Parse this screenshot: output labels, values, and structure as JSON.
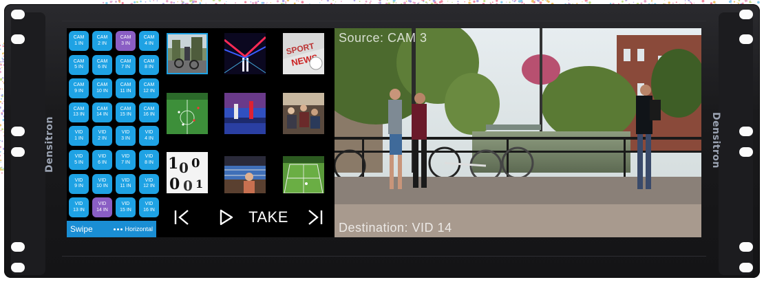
{
  "device": {
    "brand": "Densitron"
  },
  "router": {
    "buttons": [
      {
        "line1": "CAM",
        "line2": "1 IN",
        "selected": false
      },
      {
        "line1": "CAM",
        "line2": "2 IN",
        "selected": false
      },
      {
        "line1": "CAM",
        "line2": "3 IN",
        "selected": true
      },
      {
        "line1": "CAM",
        "line2": "4 IN",
        "selected": false
      },
      {
        "line1": "CAM",
        "line2": "5 IN",
        "selected": false
      },
      {
        "line1": "CAM",
        "line2": "6 IN",
        "selected": false
      },
      {
        "line1": "CAM",
        "line2": "7 IN",
        "selected": false
      },
      {
        "line1": "CAM",
        "line2": "8 IN",
        "selected": false
      },
      {
        "line1": "CAM",
        "line2": "9 IN",
        "selected": false
      },
      {
        "line1": "CAM",
        "line2": "10 IN",
        "selected": false
      },
      {
        "line1": "CAM",
        "line2": "11 IN",
        "selected": false
      },
      {
        "line1": "CAM",
        "line2": "12 IN",
        "selected": false
      },
      {
        "line1": "CAM",
        "line2": "13 IN",
        "selected": false
      },
      {
        "line1": "CAM",
        "line2": "14 IN",
        "selected": false
      },
      {
        "line1": "CAM",
        "line2": "15 IN",
        "selected": false
      },
      {
        "line1": "CAM",
        "line2": "16 IN",
        "selected": false
      },
      {
        "line1": "VID",
        "line2": "1 IN",
        "selected": false
      },
      {
        "line1": "VID",
        "line2": "2 IN",
        "selected": false
      },
      {
        "line1": "VID",
        "line2": "3 IN",
        "selected": false
      },
      {
        "line1": "VID",
        "line2": "4 IN",
        "selected": false
      },
      {
        "line1": "VID",
        "line2": "5 IN",
        "selected": false
      },
      {
        "line1": "VID",
        "line2": "6 IN",
        "selected": false
      },
      {
        "line1": "VID",
        "line2": "7 IN",
        "selected": false
      },
      {
        "line1": "VID",
        "line2": "8 IN",
        "selected": false
      },
      {
        "line1": "VID",
        "line2": "9 IN",
        "selected": false
      },
      {
        "line1": "VID",
        "line2": "10 IN",
        "selected": false
      },
      {
        "line1": "VID",
        "line2": "11 IN",
        "selected": false
      },
      {
        "line1": "VID",
        "line2": "12 IN",
        "selected": false
      },
      {
        "line1": "VID",
        "line2": "13 IN",
        "selected": false
      },
      {
        "line1": "VID",
        "line2": "14 IN",
        "selected": true
      },
      {
        "line1": "VID",
        "line2": "15 IN",
        "selected": false
      },
      {
        "line1": "VID",
        "line2": "16 IN",
        "selected": false
      }
    ],
    "swipe_label": "Swipe",
    "swipe_direction": "Horizontal"
  },
  "thumbnails": [
    {
      "name": "street-cyclists-thumb",
      "active": true
    },
    {
      "name": "neon-tunnel-thumb",
      "active": false
    },
    {
      "name": "sports-news-logo-thumb",
      "active": false
    },
    {
      "name": "soccer-pitch-thumb",
      "active": false
    },
    {
      "name": "arena-crowd-thumb",
      "active": false
    },
    {
      "name": "studio-crowd-thumb",
      "active": false
    },
    {
      "name": "countdown-leader-thumb",
      "active": false
    },
    {
      "name": "boxing-ring-thumb",
      "active": false
    },
    {
      "name": "tennis-court-thumb",
      "active": false
    }
  ],
  "transport": {
    "first_icon": "skip-to-start-icon",
    "play_icon": "play-icon",
    "take_label": "TAKE",
    "last_icon": "skip-to-end-icon"
  },
  "preview": {
    "source_label": "Source: CAM 3",
    "destination_label": "Destination: VID 14"
  },
  "colors": {
    "button_blue": "#1ea2e4",
    "button_selected": "#8a5ec4",
    "swipe_bar": "#1a8ed4",
    "thumbnail_active_border": "#1ea2e4"
  }
}
